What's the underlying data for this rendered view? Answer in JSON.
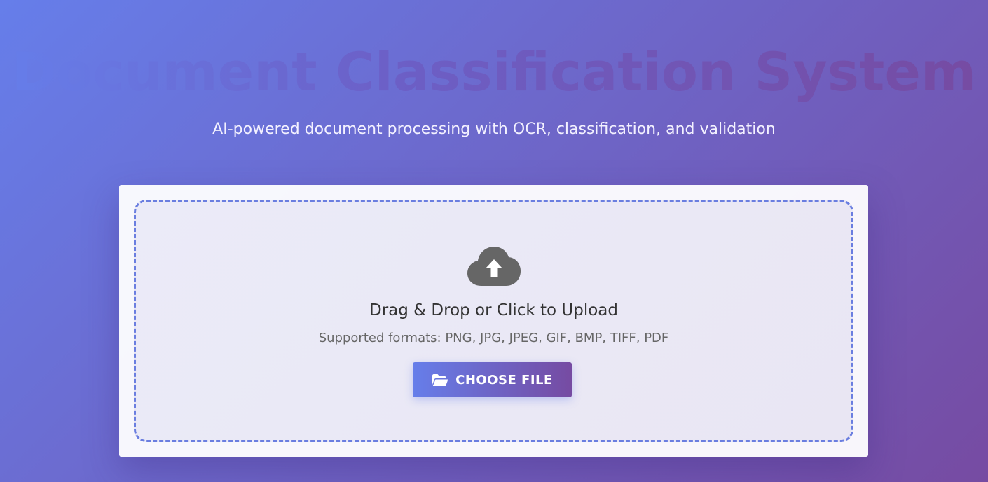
{
  "header": {
    "title": "Document Classification System",
    "subtitle": "AI-powered document processing with OCR, classification, and validation"
  },
  "upload": {
    "icon": "cloud-upload-icon",
    "title": "Drag & Drop or Click to Upload",
    "formats": "Supported formats: PNG, JPG, JPEG, GIF, BMP, TIFF, PDF",
    "button_icon": "folder-open-icon",
    "button_label": "CHOOSE FILE"
  },
  "colors": {
    "gradient_start": "#667eea",
    "gradient_end": "#764ba2",
    "icon_gray": "#666666",
    "text_dark": "#333333"
  }
}
